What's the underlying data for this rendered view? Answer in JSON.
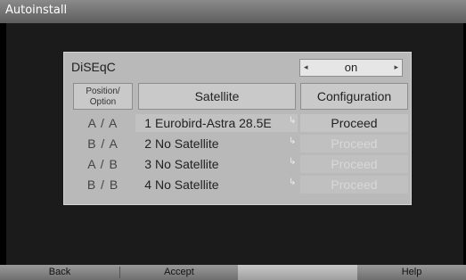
{
  "window": {
    "title": "Autoinstall"
  },
  "diseqc": {
    "label": "DiSEqC",
    "value": "on",
    "left_arrow": "◂",
    "right_arrow": "▸"
  },
  "table": {
    "headers": {
      "position_line1": "Position/",
      "position_line2": "Option",
      "satellite": "Satellite",
      "configuration": "Configuration"
    },
    "rows": [
      {
        "position": "A / A",
        "index": "1",
        "satellite": "Eurobird-Astra 28.5E",
        "mark": "↳",
        "config": "Proceed",
        "enabled": true
      },
      {
        "position": "B / A",
        "index": "2",
        "satellite": "No Satellite",
        "mark": "↳",
        "config": "Proceed",
        "enabled": false
      },
      {
        "position": "A / B",
        "index": "3",
        "satellite": "No Satellite",
        "mark": "↳",
        "config": "Proceed",
        "enabled": false
      },
      {
        "position": "B / B",
        "index": "4",
        "satellite": "No Satellite",
        "mark": "↳",
        "config": "Proceed",
        "enabled": false
      }
    ]
  },
  "buttons": {
    "back": "Back",
    "accept": "Accept",
    "help": "Help"
  }
}
